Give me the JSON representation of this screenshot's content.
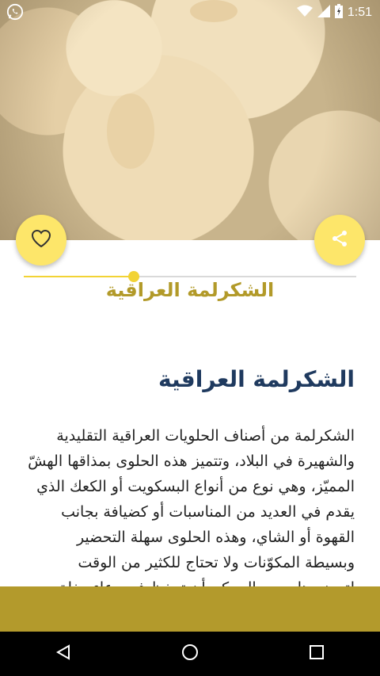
{
  "status_bar": {
    "time": "1:51",
    "icons": [
      "whatsapp-icon",
      "wifi-icon",
      "signal-icon",
      "battery-icon"
    ]
  },
  "hero": {
    "image": "shakarlama-cookies-photo"
  },
  "actions": {
    "favorite_icon": "heart-outline-icon",
    "share_icon": "share-icon"
  },
  "title_strip": {
    "title": "الشكرلمة العراقية",
    "progress": 0.33
  },
  "article": {
    "heading": "الشكرلمة العراقية",
    "body": "الشكرلمة من أصناف الحلويات العراقية التقليدية والشهيرة في البلاد، وتتميز هذه الحلوى بمذاقها الهشّ المميّز، وهي نوع من أنواع البسكويت أو الكعك الذي يقدم في العديد من المناسبات أو كضيافة بجانب القهوة أو الشاي، وهذه الحلوى سهلة التحضير وبسيطة المكوّنات ولا تحتاج للكثير من الوقت لتحضيرها، ومن الممكن أن تحفظ في وعاء مغلق بدرجة حرارة الغرفة لعدة أيام"
  },
  "colors": {
    "accent": "#fde66a",
    "title": "#b29a29",
    "heading": "#1f3a5f",
    "band": "#b39a2c"
  },
  "navigation": {
    "buttons": [
      "back-icon",
      "home-icon",
      "recents-icon"
    ]
  }
}
